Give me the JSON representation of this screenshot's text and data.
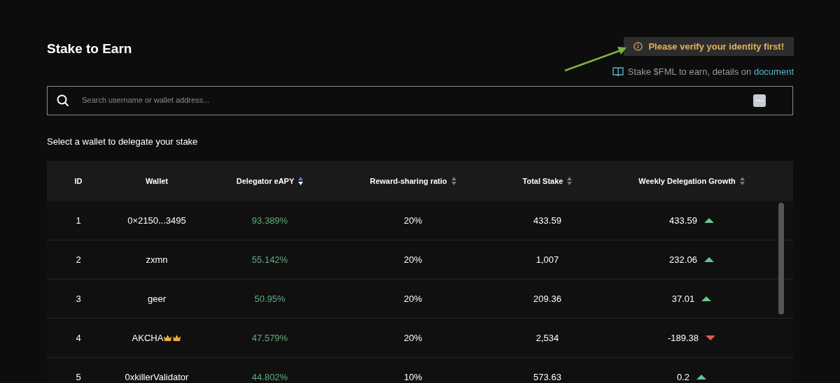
{
  "title": "Stake to Earn",
  "notice": {
    "text": "Please verify your identity first!"
  },
  "info": {
    "text": "Stake $FML to earn, details on ",
    "link": "document"
  },
  "search": {
    "placeholder": "Search username or wallet address..."
  },
  "subtitle": "Select a wallet to delegate your stake",
  "table": {
    "columns": [
      {
        "label": "ID",
        "sortable": false
      },
      {
        "label": "Wallet",
        "sortable": false
      },
      {
        "label": "Delegator eAPY",
        "sortable": true,
        "sorted": true
      },
      {
        "label": "Reward-sharing ratio",
        "sortable": true,
        "sorted": false
      },
      {
        "label": "Total Stake",
        "sortable": true,
        "sorted": false
      },
      {
        "label": "Weekly Delegation Growth",
        "sortable": true,
        "sorted": false
      }
    ],
    "rows": [
      {
        "id": "1",
        "wallet": "0×2150...3495",
        "eapy": "93.389%",
        "ratio": "20%",
        "stake": "433.59",
        "growth": "433.59",
        "rising": true
      },
      {
        "id": "2",
        "wallet": "zxmn",
        "eapy": "55.142%",
        "ratio": "20%",
        "stake": "1,007",
        "growth": "232.06",
        "rising": true
      },
      {
        "id": "3",
        "wallet": "geer",
        "eapy": "50.95%",
        "ratio": "20%",
        "stake": "209.36",
        "growth": "37.01",
        "rising": true
      },
      {
        "id": "4",
        "wallet": "AKCHA",
        "crowned": true,
        "eapy": "47.579%",
        "ratio": "20%",
        "stake": "2,534",
        "growth": "-189.38",
        "rising": false
      },
      {
        "id": "5",
        "wallet": "0xkillerValidator",
        "eapy": "44.802%",
        "ratio": "10%",
        "stake": "573.63",
        "growth": "0.2",
        "rising": true
      }
    ]
  }
}
